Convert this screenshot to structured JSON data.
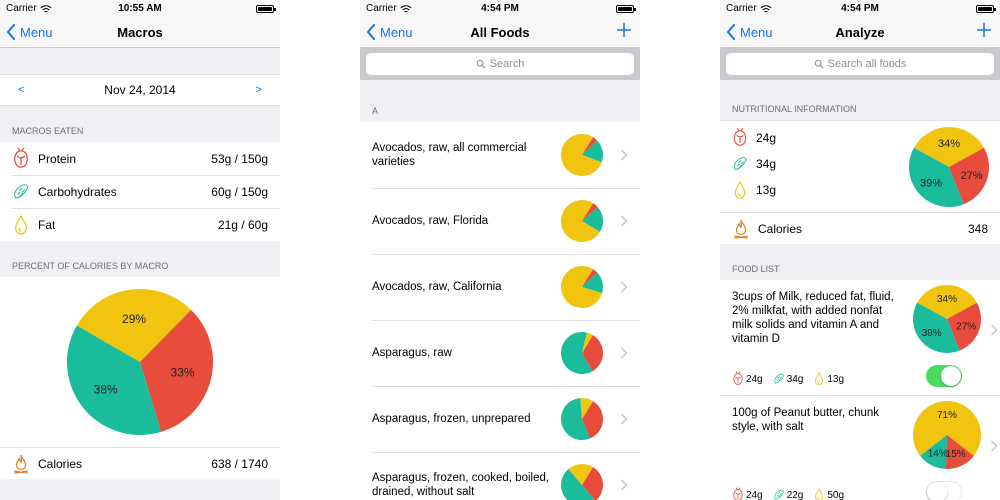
{
  "colors": {
    "protein": "#e84c3d",
    "carbs": "#1abc9c",
    "fat": "#f1c40f",
    "calories": "#e67e22",
    "accent": "#1a73e8",
    "toggle_on": "#4cd964"
  },
  "screen1": {
    "status": {
      "carrier": "Carrier",
      "time": "10:55 AM"
    },
    "nav": {
      "back": "Menu",
      "title": "Macros"
    },
    "date": {
      "prev": "<",
      "value": "Nov 24, 2014",
      "next": ">"
    },
    "macros_header": "MACROS EATEN",
    "macros": [
      {
        "label": "Protein",
        "value": "53g / 150g",
        "icon": "protein-icon"
      },
      {
        "label": "Carbohydrates",
        "value": "60g / 150g",
        "icon": "carbs-icon"
      },
      {
        "label": "Fat",
        "value": "21g / 60g",
        "icon": "fat-icon"
      }
    ],
    "percent_header": "PERCENT OF CALORIES BY MACRO",
    "chart_data": {
      "type": "pie",
      "slices": [
        {
          "name": "Protein",
          "value": 33,
          "label": "33%"
        },
        {
          "name": "Carbohydrates",
          "value": 38,
          "label": "38%"
        },
        {
          "name": "Fat",
          "value": 29,
          "label": "29%"
        }
      ]
    },
    "calories": {
      "label": "Calories",
      "value": "638 / 1740"
    }
  },
  "screen2": {
    "status": {
      "carrier": "Carrier",
      "time": "4:54 PM"
    },
    "nav": {
      "back": "Menu",
      "title": "All Foods"
    },
    "search_placeholder": "Search",
    "section": "A",
    "foods": [
      {
        "name": "Avocados, raw, all commercial varieties",
        "pie": {
          "protein": 4,
          "carbs": 18,
          "fat": 78
        }
      },
      {
        "name": "Avocados, raw, Florida",
        "pie": {
          "protein": 5,
          "carbs": 20,
          "fat": 75
        }
      },
      {
        "name": "Avocados, raw, California",
        "pie": {
          "protein": 4,
          "carbs": 17,
          "fat": 79
        }
      },
      {
        "name": "Asparagus, raw",
        "pie": {
          "protein": 33,
          "carbs": 62,
          "fat": 5
        }
      },
      {
        "name": "Asparagus, frozen, unprepared",
        "pie": {
          "protein": 35,
          "carbs": 55,
          "fat": 10
        }
      },
      {
        "name": "Asparagus, frozen, cooked, boiled, drained, without salt",
        "pie": {
          "protein": 30,
          "carbs": 50,
          "fat": 20
        }
      }
    ]
  },
  "screen3": {
    "status": {
      "carrier": "Carrier",
      "time": "4:54 PM"
    },
    "nav": {
      "back": "Menu",
      "title": "Analyze"
    },
    "search_placeholder": "Search all foods",
    "nutrition_header": "NUTRITIONAL INFORMATION",
    "nutrition": {
      "protein": "24g",
      "carbs": "34g",
      "fat": "13g"
    },
    "chart_data": {
      "type": "pie",
      "slices": [
        {
          "name": "Protein",
          "value": 27,
          "label": "27%"
        },
        {
          "name": "Carbohydrates",
          "value": 39,
          "label": "39%"
        },
        {
          "name": "Fat",
          "value": 34,
          "label": "34%"
        }
      ]
    },
    "calories": {
      "label": "Calories",
      "value": "348"
    },
    "food_list_header": "FOOD LIST",
    "food_list": [
      {
        "name": "3cups of Milk, reduced fat, fluid, 2% milkfat, with added nonfat milk solids and vitamin A and vitamin D",
        "pie": [
          {
            "name": "Protein",
            "value": 27,
            "label": "27%"
          },
          {
            "name": "Carbohydrates",
            "value": 39,
            "label": "39%"
          },
          {
            "name": "Fat",
            "value": 34,
            "label": "34%"
          }
        ],
        "protein": "24g",
        "carbs": "34g",
        "fat": "13g",
        "toggle": true
      },
      {
        "name": "100g of Peanut butter, chunk style, with salt",
        "pie": [
          {
            "name": "Protein",
            "value": 15,
            "label": "15%"
          },
          {
            "name": "Carbohydrates",
            "value": 14,
            "label": "14%"
          },
          {
            "name": "Fat",
            "value": 71,
            "label": "71%"
          }
        ],
        "protein": "24g",
        "carbs": "22g",
        "fat": "50g",
        "toggle": false
      }
    ]
  }
}
